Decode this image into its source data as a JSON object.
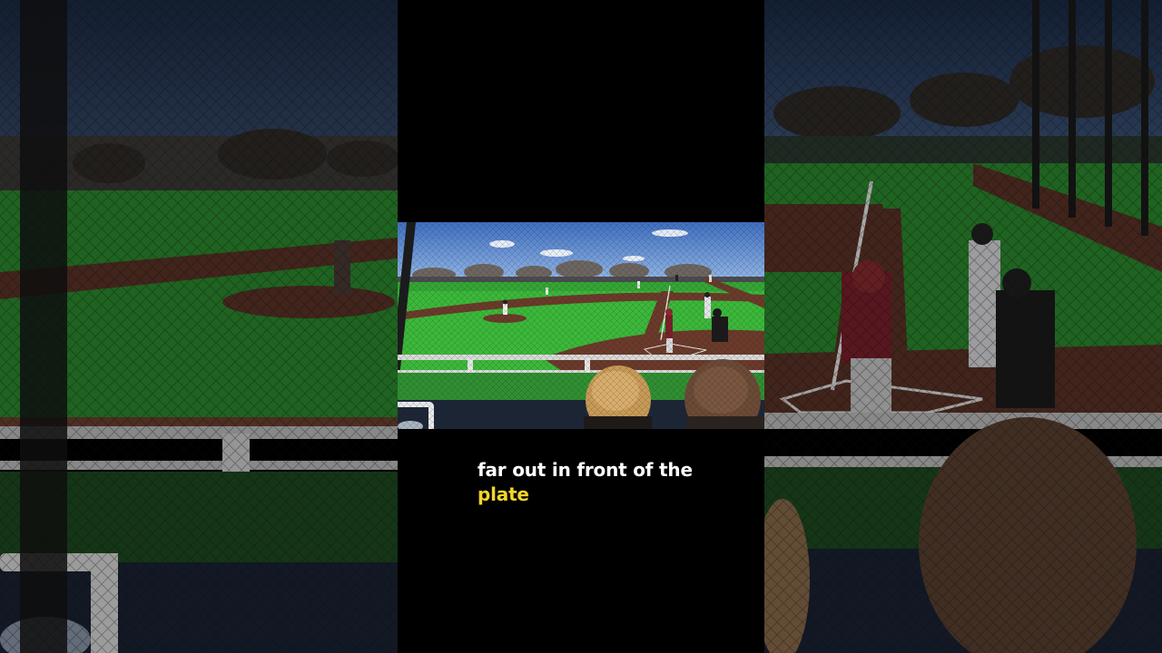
{
  "caption": {
    "line1": "far out in front of the",
    "line2": "plate"
  },
  "colors": {
    "caption_text": "#ffffff",
    "caption_highlight": "#f2d52b",
    "background": "#000000",
    "sky": "#4a78c4",
    "infield_grass": "#3db53a",
    "dirt": "#6b3a2a"
  }
}
